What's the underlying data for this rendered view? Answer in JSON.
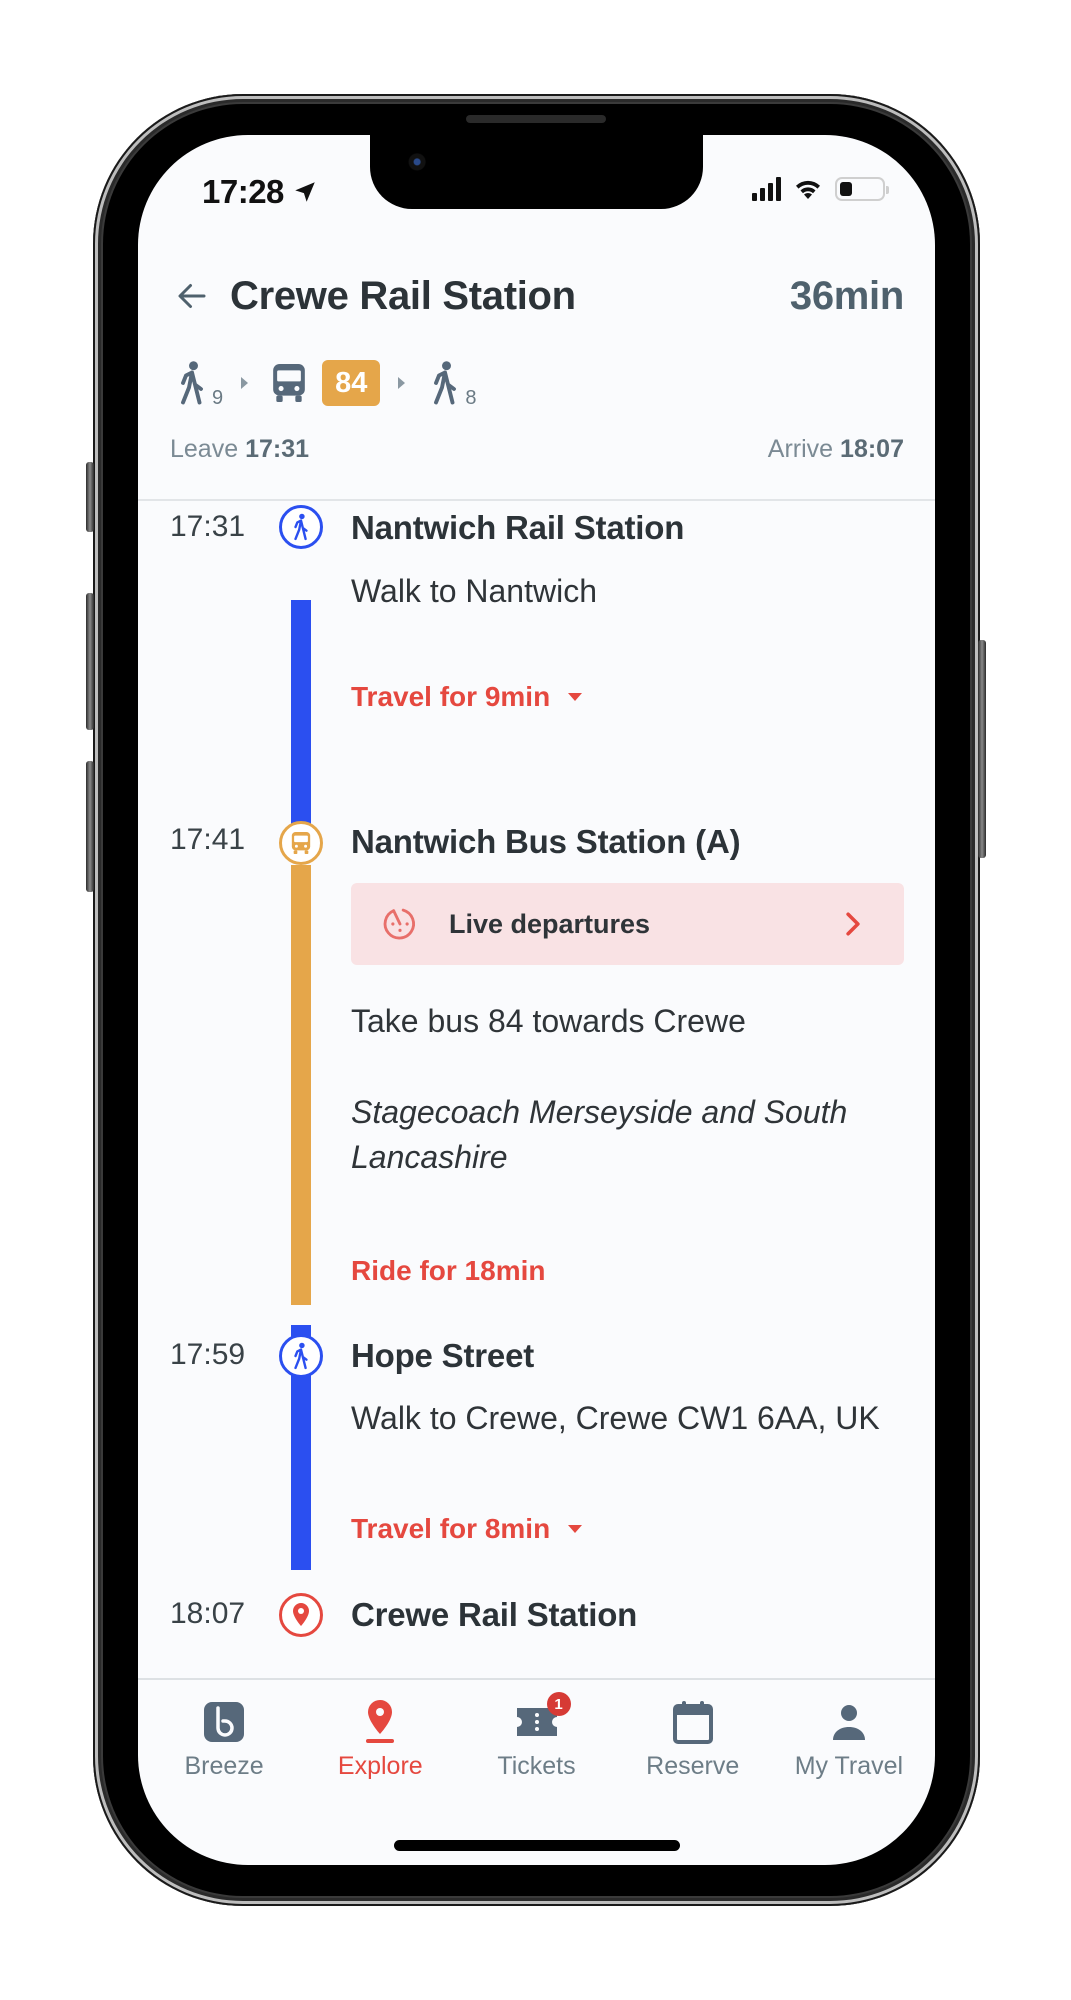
{
  "status_bar": {
    "time": "17:28",
    "location_icon": "location-arrow-icon",
    "signal_icon": "cellular-signal-icon",
    "wifi_icon": "wifi-icon",
    "battery_icon": "battery-icon",
    "battery_level": 0.3
  },
  "header": {
    "back_icon": "arrow-left-icon",
    "title": "Crewe Rail Station",
    "duration": "36min",
    "modes": [
      {
        "type": "walk",
        "icon": "walk-icon",
        "minutes": "9"
      },
      {
        "type": "bus",
        "icon": "bus-icon",
        "route": "84"
      },
      {
        "type": "walk",
        "icon": "walk-icon",
        "minutes": "8"
      }
    ],
    "leave_label": "Leave",
    "leave_time": "17:31",
    "arrive_label": "Arrive",
    "arrive_time": "18:07"
  },
  "timeline": {
    "stops": [
      {
        "time": "17:31",
        "name": "Nantwich Rail Station",
        "icon": "walk-icon",
        "description": "Walk to Nantwich",
        "travel_label": "Travel for 9min"
      },
      {
        "time": "17:41",
        "name": "Nantwich Bus Station (A)",
        "icon": "bus-icon",
        "live_departures_label": "Live departures",
        "live_icon": "clock-refresh-icon",
        "description": "Take bus 84 towards Crewe",
        "operator": "Stagecoach Merseyside and South Lancashire",
        "travel_label": "Ride for 18min"
      },
      {
        "time": "17:59",
        "name": "Hope Street",
        "icon": "walk-icon",
        "description": "Walk to Crewe, Crewe CW1 6AA, UK",
        "travel_label": "Travel for 8min"
      },
      {
        "time": "18:07",
        "name": "Crewe Rail Station",
        "icon": "map-pin-icon"
      }
    ]
  },
  "bottom_nav": {
    "items": [
      {
        "label": "Breeze",
        "icon": "breeze-logo-icon",
        "active": false
      },
      {
        "label": "Explore",
        "icon": "map-pin-icon",
        "active": true
      },
      {
        "label": "Tickets",
        "icon": "ticket-icon",
        "active": false,
        "badge": "1"
      },
      {
        "label": "Reserve",
        "icon": "calendar-icon",
        "active": false
      },
      {
        "label": "My Travel",
        "icon": "person-icon",
        "active": false
      }
    ]
  },
  "colors": {
    "walk": "#2b4ff0",
    "bus": "#e5a64a",
    "accent": "#e5483f",
    "live_bg": "#f9e2e4",
    "nav_inactive": "#56687a"
  }
}
